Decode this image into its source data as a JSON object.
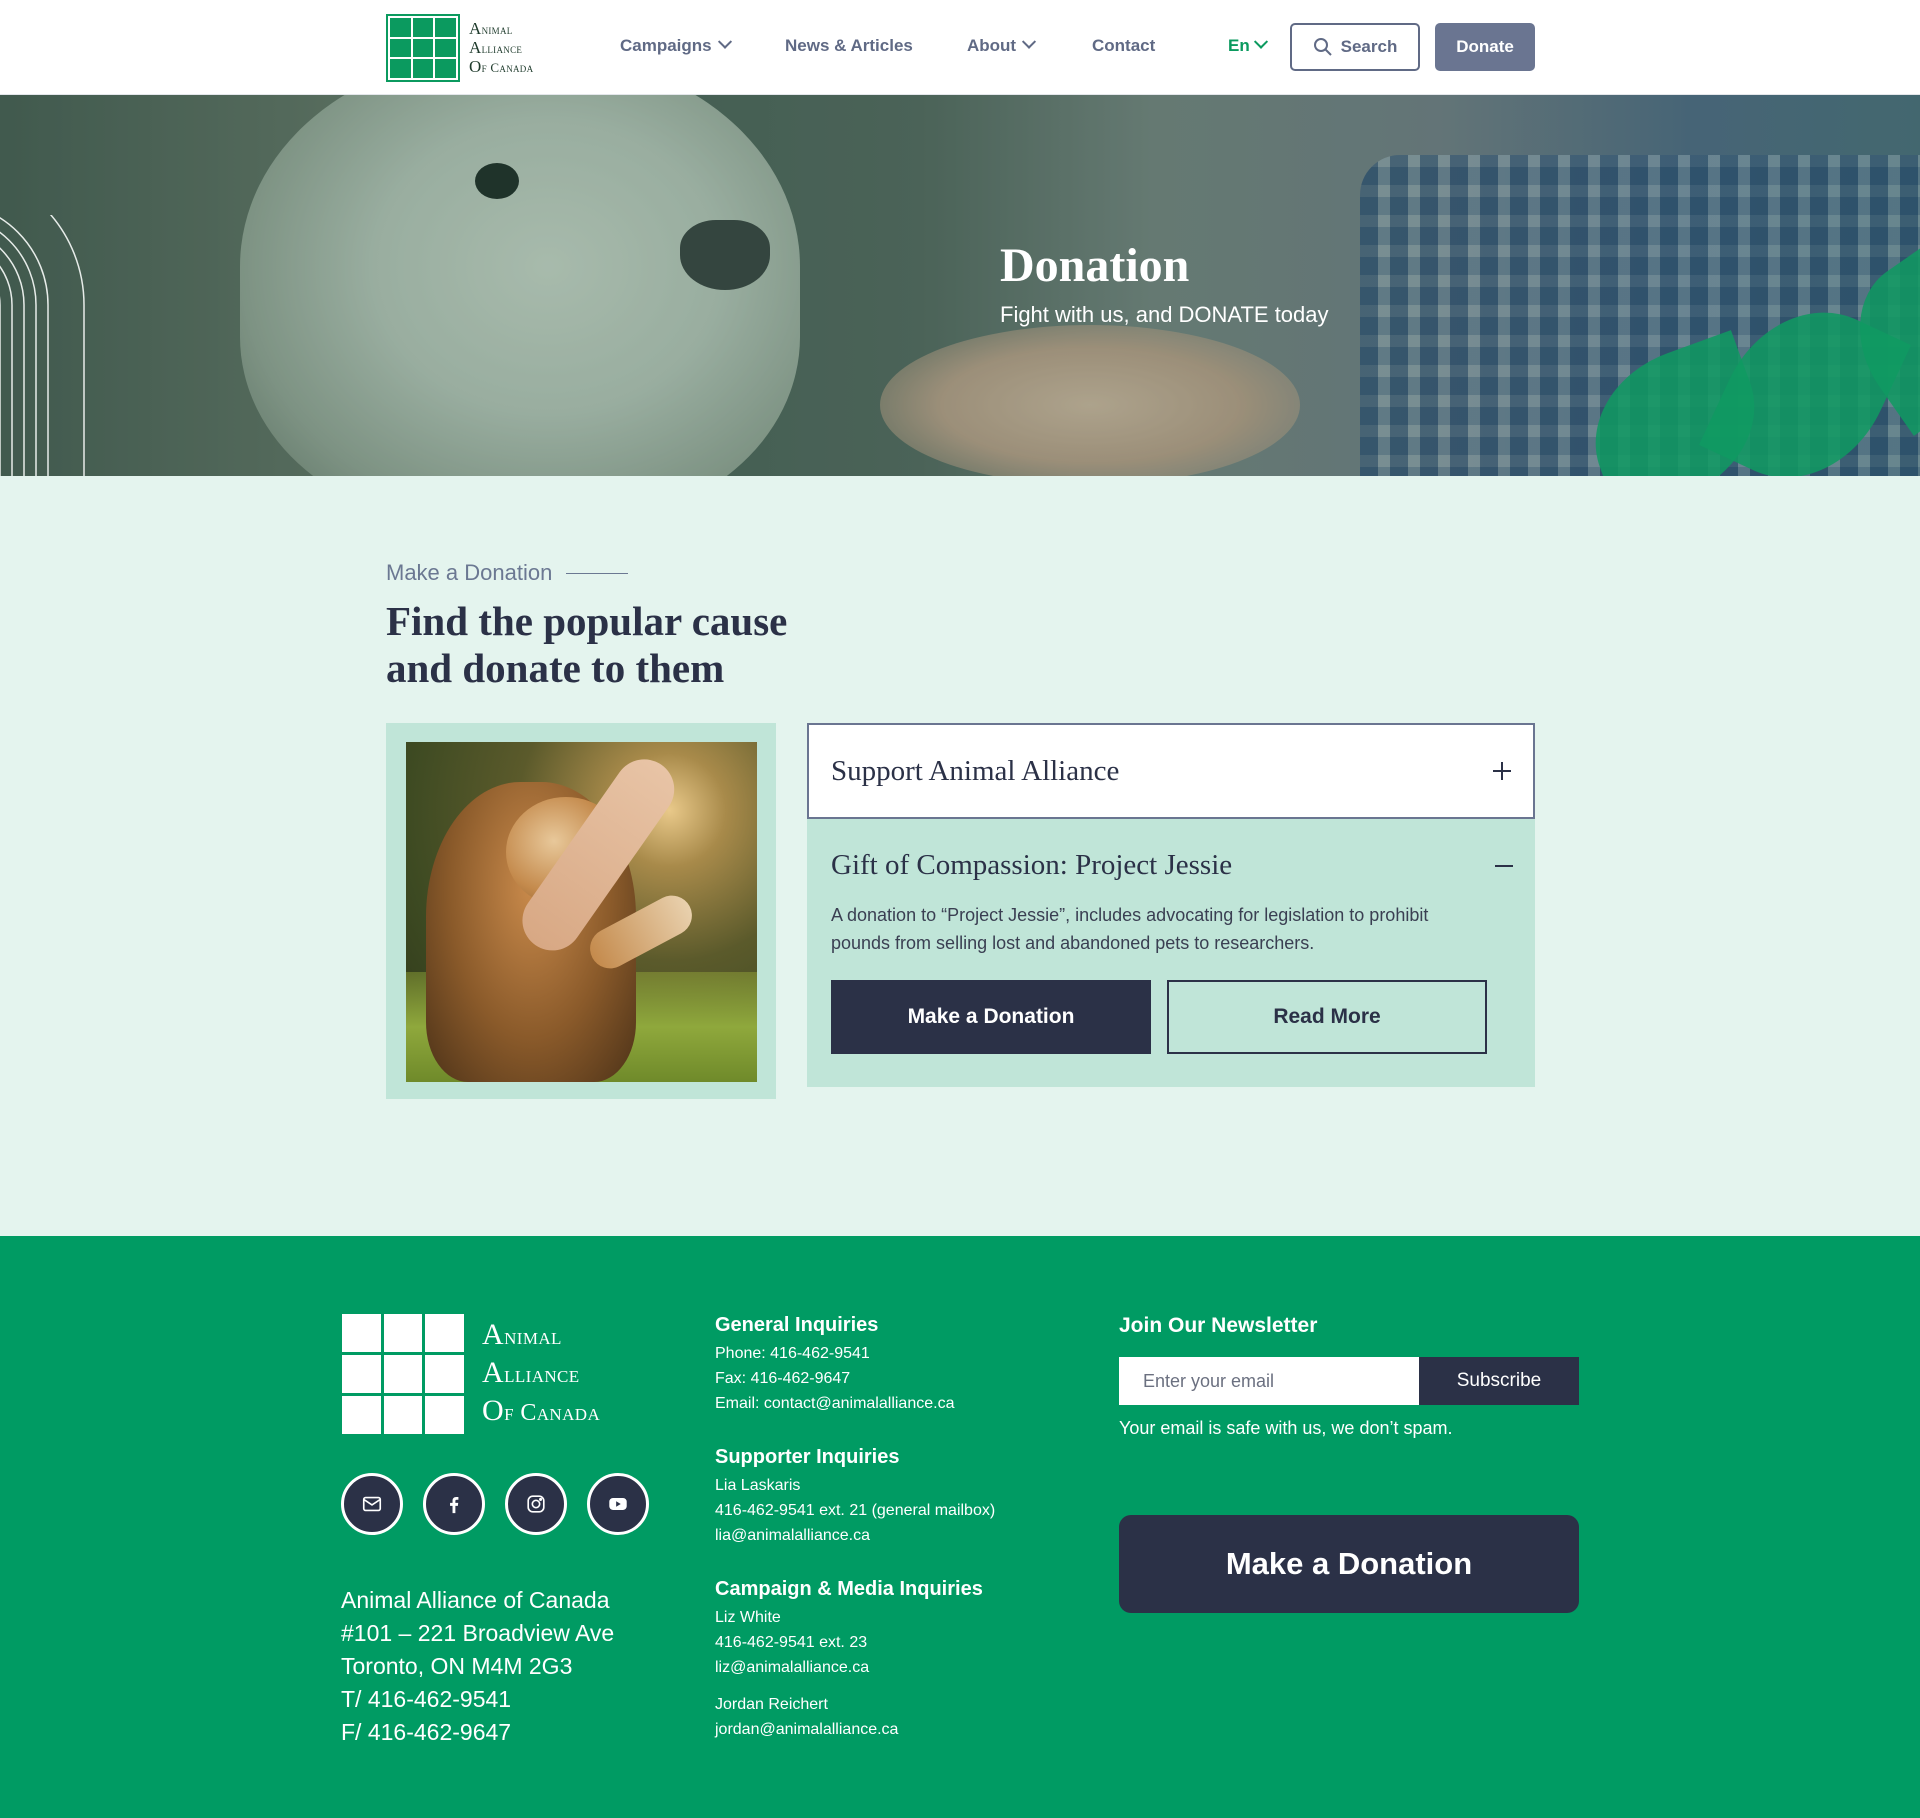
{
  "header": {
    "logo_lines": [
      "Animal",
      "Alliance",
      "Of Canada"
    ],
    "nav": [
      {
        "label": "Campaigns",
        "has_dropdown": true
      },
      {
        "label": "News & Articles",
        "has_dropdown": false
      },
      {
        "label": "About",
        "has_dropdown": true
      },
      {
        "label": "Contact",
        "has_dropdown": false
      }
    ],
    "language": "En",
    "search_label": "Search",
    "donate_label": "Donate"
  },
  "hero": {
    "title": "Donation",
    "subtitle": "Fight with us, and DONATE today"
  },
  "main": {
    "eyebrow": "Make a Donation",
    "title": "Find the popular cause and donate to them",
    "accordion": [
      {
        "title": "Support Animal Alliance",
        "expanded": false
      },
      {
        "title": "Gift of Compassion: Project Jessie",
        "expanded": true,
        "description": "A donation to “Project Jessie”, includes advocating for legislation to prohibit pounds from selling lost and abandoned pets to researchers.",
        "primary_button": "Make a Donation",
        "secondary_button": "Read More"
      }
    ]
  },
  "footer": {
    "logo_lines": [
      "Animal",
      "Alliance",
      "Of Canada"
    ],
    "socials": [
      "mail-icon",
      "facebook-icon",
      "instagram-icon",
      "youtube-icon"
    ],
    "address": [
      "Animal Alliance of Canada",
      "#101 – 221 Broadview Ave",
      "Toronto, ON M4M 2G3",
      "T/  416-462-9541",
      "F/  416-462-9647"
    ],
    "general": {
      "heading": "General Inquiries",
      "phone": "Phone: 416-462-9541",
      "fax": "Fax: 416-462-9647",
      "email": "Email: contact@animalalliance.ca"
    },
    "supporter": {
      "heading": "Supporter Inquiries",
      "name": "Lia Laskaris",
      "phone": "416-462-9541 ext. 21 (general mailbox)",
      "email": "lia@animalalliance.ca"
    },
    "campaign": {
      "heading": "Campaign & Media Inquiries",
      "name": "Liz White",
      "phone": "416-462-9541 ext. 23",
      "email": "liz@animalalliance.ca",
      "name2": "Jordan Reichert",
      "email2": "jordan@animalalliance.ca"
    },
    "newsletter": {
      "heading": "Join Our Newsletter",
      "placeholder": "Enter your email",
      "subscribe_label": "Subscribe",
      "note": "Your email is safe with us, we don’t spam."
    },
    "donate_label": "Make a Donation"
  },
  "colors": {
    "brand_green": "#009b63",
    "navy": "#2b3147",
    "slate": "#6a7591",
    "mint": "#c0e5d8",
    "page_bg": "#e4f4ee"
  }
}
